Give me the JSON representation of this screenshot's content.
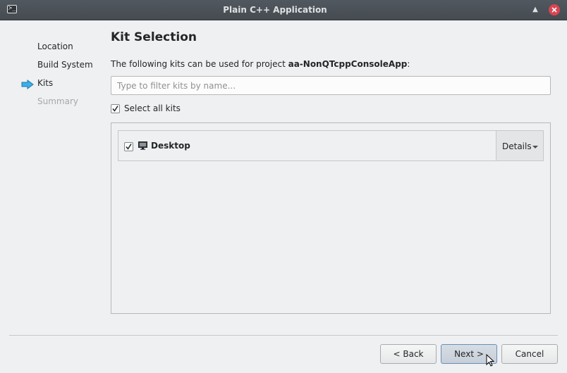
{
  "window": {
    "title": "Plain C++ Application",
    "app_icon": "terminal-icon",
    "app_icon_glyph": "≻_"
  },
  "steps": [
    {
      "label": "Location",
      "state": "done"
    },
    {
      "label": "Build System",
      "state": "done"
    },
    {
      "label": "Kits",
      "state": "current"
    },
    {
      "label": "Summary",
      "state": "pending"
    }
  ],
  "page": {
    "heading": "Kit Selection",
    "intro_prefix": "The following kits can be used for project ",
    "project_name": "aa-NonQTcppConsoleApp",
    "intro_suffix": ":"
  },
  "filter": {
    "placeholder": "Type to filter kits by name...",
    "value": ""
  },
  "select_all": {
    "label": "Select all kits",
    "checked": true
  },
  "kits": [
    {
      "name": "Desktop",
      "checked": true,
      "icon": "monitor-icon",
      "details_label": "Details"
    }
  ],
  "buttons": {
    "back": "< Back",
    "next": "Next >",
    "cancel": "Cancel"
  },
  "colors": {
    "close_button": "#da4453",
    "step_arrow": "#3daee9",
    "titlebar": "#4b5157"
  }
}
